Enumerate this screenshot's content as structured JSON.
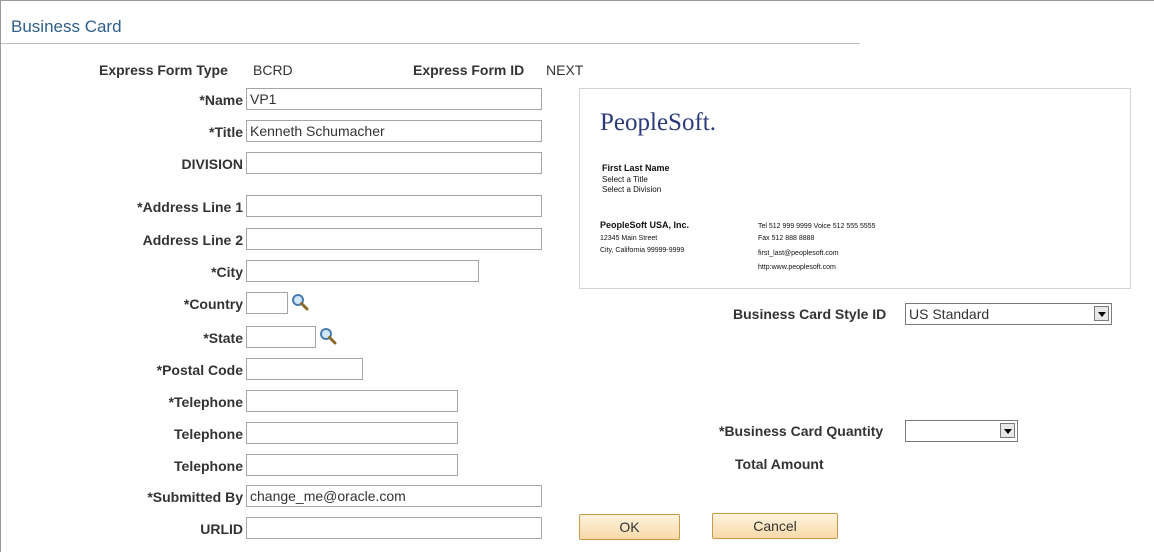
{
  "page_title": "Business Card",
  "header": {
    "form_type_label": "Express Form Type",
    "form_type_value": "BCRD",
    "form_id_label": "Express Form ID",
    "form_id_value": "NEXT"
  },
  "fields": {
    "name": {
      "label": "*Name",
      "value": "VP1"
    },
    "title": {
      "label": "*Title",
      "value": "Kenneth Schumacher"
    },
    "division": {
      "label": "DIVISION",
      "value": ""
    },
    "address1": {
      "label": "*Address Line 1",
      "value": ""
    },
    "address2": {
      "label": "Address Line 2",
      "value": ""
    },
    "city": {
      "label": "*City",
      "value": ""
    },
    "country": {
      "label": "*Country",
      "value": ""
    },
    "state": {
      "label": "*State",
      "value": ""
    },
    "postal": {
      "label": "*Postal Code",
      "value": ""
    },
    "telephone1": {
      "label": "*Telephone",
      "value": ""
    },
    "telephone2": {
      "label": "Telephone",
      "value": ""
    },
    "telephone3": {
      "label": "Telephone",
      "value": ""
    },
    "submitted_by": {
      "label": "*Submitted By",
      "value": "change_me@oracle.com"
    },
    "urlid": {
      "label": "URLID",
      "value": ""
    }
  },
  "card_preview": {
    "logo": "PeopleSoft.",
    "name": "First Last Name",
    "title_line": "Select a Title",
    "division_line": "Select a Division",
    "company": "PeopleSoft USA, Inc.",
    "street": "12345 Main Street",
    "city_line": "City, California 99999-9999",
    "phone_line": "Tel 512 999 9999  Voice 512 555 5555",
    "fax_line": "Fax 512 888 8888",
    "email_line": "first_last@peoplesoft.com",
    "web_line": "http:www.peoplesoft.com"
  },
  "style": {
    "label": "Business Card Style ID",
    "selected": "US Standard"
  },
  "quantity": {
    "label": "*Business Card Quantity",
    "selected": ""
  },
  "total_amount_label": "Total Amount",
  "buttons": {
    "ok": "OK",
    "cancel": "Cancel"
  },
  "icons": {
    "lookup": "magnifier-icon",
    "dropdown": "dropdown-arrow-icon"
  }
}
